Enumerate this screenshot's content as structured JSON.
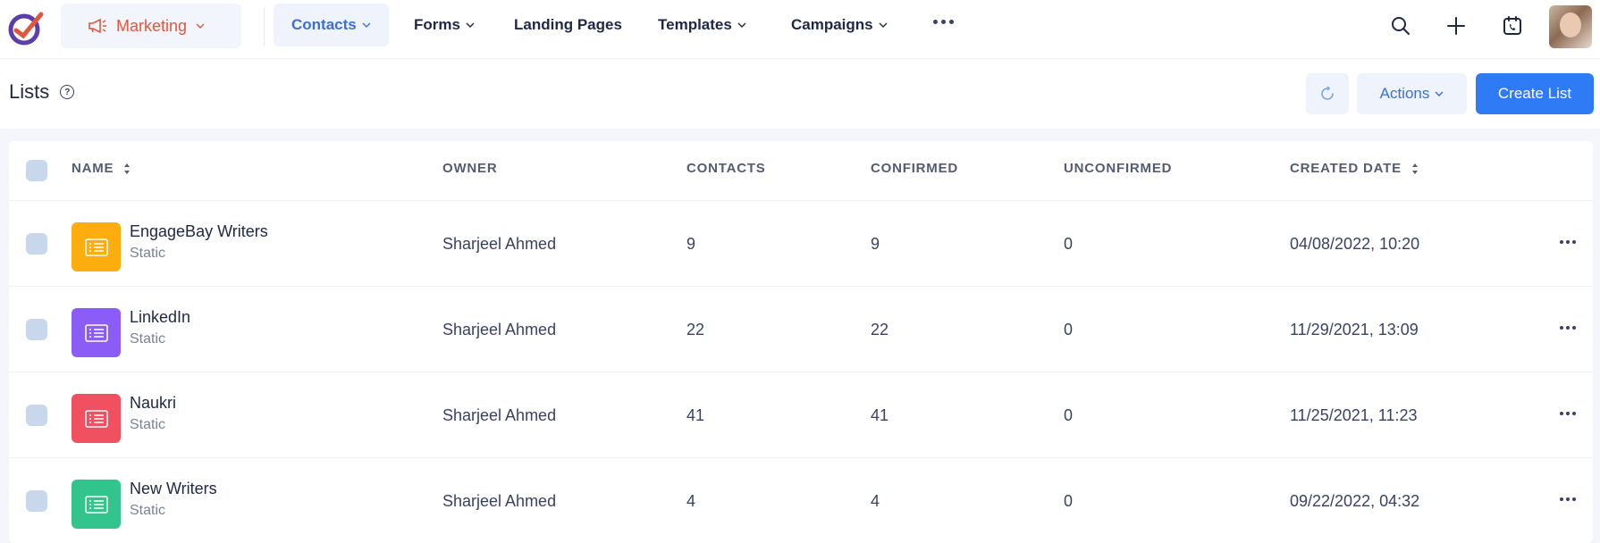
{
  "nav": {
    "app_label": "Marketing",
    "items": [
      {
        "label": "Contacts",
        "has_caret": true,
        "active": true
      },
      {
        "label": "Forms",
        "has_caret": true,
        "active": false
      },
      {
        "label": "Landing Pages",
        "has_caret": false,
        "active": false
      },
      {
        "label": "Templates",
        "has_caret": true,
        "active": false
      },
      {
        "label": "Campaigns",
        "has_caret": true,
        "active": false
      }
    ],
    "icons": [
      "search-icon",
      "plus-icon",
      "calendar-phone-icon",
      "more-icon"
    ]
  },
  "header": {
    "title": "Lists",
    "actions_label": "Actions",
    "create_label": "Create List"
  },
  "table": {
    "columns": [
      "NAME",
      "OWNER",
      "CONTACTS",
      "CONFIRMED",
      "UNCONFIRMED",
      "CREATED DATE"
    ],
    "rows": [
      {
        "name": "EngageBay Writers",
        "type": "Static",
        "owner": "Sharjeel Ahmed",
        "contacts": "9",
        "confirmed": "9",
        "unconfirmed": "0",
        "created": "04/08/2022, 10:20",
        "color": "#fdad0d"
      },
      {
        "name": "LinkedIn",
        "type": "Static",
        "owner": "Sharjeel Ahmed",
        "contacts": "22",
        "confirmed": "22",
        "unconfirmed": "0",
        "created": "11/29/2021, 13:09",
        "color": "#8b5cf6"
      },
      {
        "name": "Naukri",
        "type": "Static",
        "owner": "Sharjeel Ahmed",
        "contacts": "41",
        "confirmed": "41",
        "unconfirmed": "0",
        "created": "11/25/2021, 11:23",
        "color": "#f0505f"
      },
      {
        "name": "New Writers",
        "type": "Static",
        "owner": "Sharjeel Ahmed",
        "contacts": "4",
        "confirmed": "4",
        "unconfirmed": "0",
        "created": "09/22/2022, 04:32",
        "color": "#33c48d"
      }
    ]
  },
  "colors": {
    "accent": "#2f7bf5",
    "brand": "#e0573e",
    "active_nav": "#3d6fd6"
  }
}
